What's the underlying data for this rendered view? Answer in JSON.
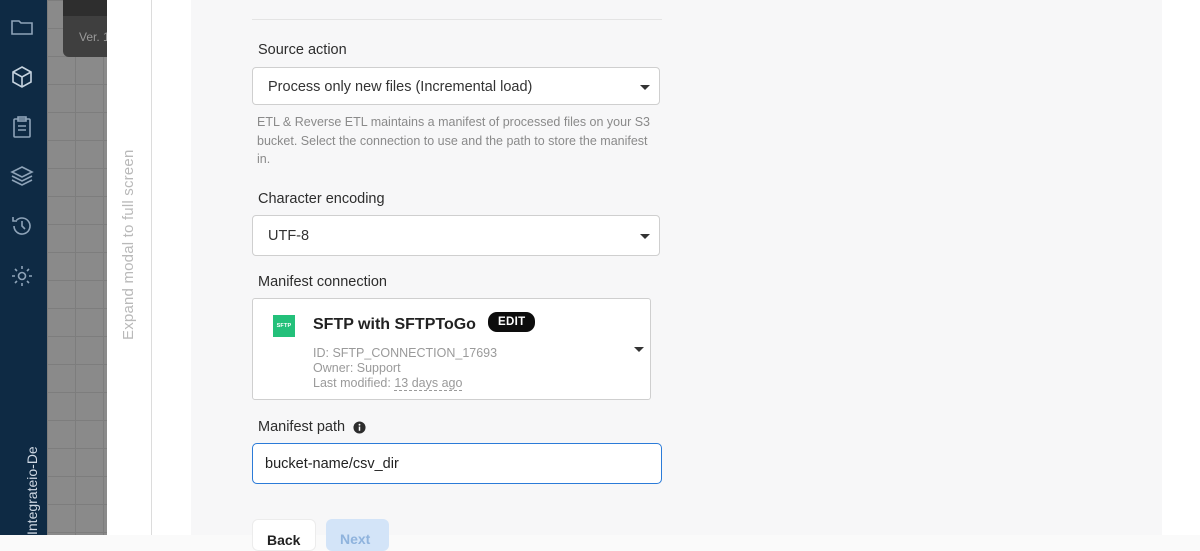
{
  "sidebar": {
    "org_label": "Integrateio-De",
    "icons": [
      "folder-icon",
      "package-icon",
      "clipboard-icon",
      "layers-icon",
      "history-icon",
      "gear-icon"
    ]
  },
  "background": {
    "card_label": "Ver. 1"
  },
  "modal": {
    "expand_label": "Expand modal to full screen",
    "source_action": {
      "label": "Source action",
      "value": "Process only new files (Incremental load)",
      "helper": "ETL & Reverse ETL maintains a manifest of processed files on your S3 bucket. Select the connection to use and the path to store the manifest in."
    },
    "encoding": {
      "label": "Character encoding",
      "value": "UTF-8"
    },
    "manifest_connection": {
      "label": "Manifest connection",
      "logo_text": "SFTP",
      "name": "SFTP with SFTPToGo",
      "edit_label": "EDIT",
      "id_text": "ID: SFTP_CONNECTION_17693",
      "owner_text": "Owner: Support",
      "modified_prefix": "Last modified:",
      "modified_value": "13 days ago"
    },
    "manifest_path": {
      "label": "Manifest path",
      "value": "bucket-name/csv_dir"
    },
    "buttons": {
      "back": "Back",
      "next": "Next"
    }
  },
  "colors": {
    "sidebar": "#0e2a44",
    "accent": "#2b7bd8",
    "sftp_green": "#23c07a"
  }
}
